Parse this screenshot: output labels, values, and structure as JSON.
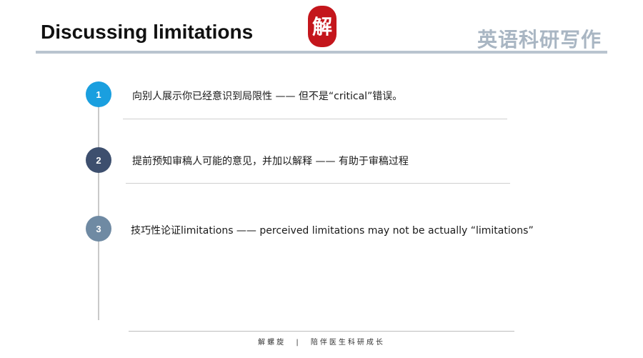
{
  "header": {
    "title": "Discussing limitations",
    "brand": "英语科研写作",
    "seal_glyph": "解"
  },
  "colors": {
    "step1": "#1a9fdf",
    "step2": "#3d4f6e",
    "step3": "#6f8aa3",
    "seal": "#c4161c",
    "brand_text": "#a9b6c3"
  },
  "steps": [
    {
      "number": "1",
      "text": "向别人展示你已经意识到局限性 —— 但不是“critical”错误。"
    },
    {
      "number": "2",
      "text": "提前预知审稿人可能的意见，并加以解释 —— 有助于审稿过程"
    },
    {
      "number": "3",
      "text": "技巧性论证limitations —— perceived limitations may not be actually “limitations”"
    }
  ],
  "footer": {
    "left": "解螺旋",
    "separator": "|",
    "right": "陪伴医生科研成长"
  }
}
